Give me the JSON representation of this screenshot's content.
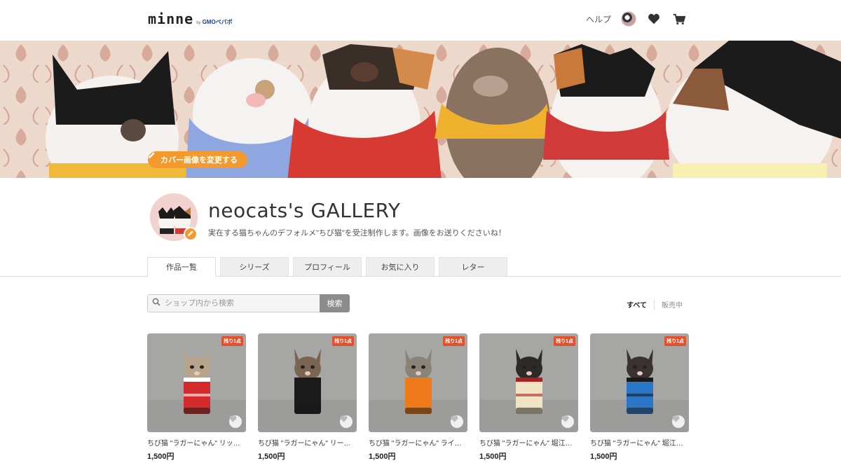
{
  "header": {
    "logo": "minne",
    "logo_by": "by",
    "logo_company": "GMOペパボ",
    "help_label": "ヘルプ",
    "icons": [
      "avatar",
      "heart-icon",
      "cart-icon"
    ]
  },
  "cover": {
    "change_button_label": "カバー画像を変更する",
    "accent_color": "#f29a2e"
  },
  "profile": {
    "shop_name": "neocats's GALLERY",
    "description": "実在する猫ちゃんのデフォルメ\"ちび猫\"を受注制作します。画像をお送りくださいね！"
  },
  "tabs": [
    {
      "label": "作品一覧",
      "active": true
    },
    {
      "label": "シリーズ",
      "active": false
    },
    {
      "label": "プロフィール",
      "active": false
    },
    {
      "label": "お気に入り",
      "active": false
    },
    {
      "label": "レター",
      "active": false
    }
  ],
  "search": {
    "placeholder": "ショップ内から検索",
    "button_label": "検索"
  },
  "filter": {
    "all_label": "すべて",
    "on_sale_label": "販売中"
  },
  "products": [
    {
      "badge": "残り1点",
      "title": "ちび猫 \"ラガーにゃん\" リッチ…",
      "price": "1,500円",
      "sweater": "#d32b2b",
      "sweater2": "#ffffff",
      "cat": "#b8a48a"
    },
    {
      "badge": "残り1点",
      "title": "ちび猫 \"ラガーにゃん\" リーコ…",
      "price": "1,500円",
      "sweater": "#1a1a1a",
      "sweater2": "#1a1a1a",
      "cat": "#7a6452"
    },
    {
      "badge": "残り1点",
      "title": "ちび猫 \"ラガーにゃん\" ライア…",
      "price": "1,500円",
      "sweater": "#ef7a1a",
      "sweater2": "#ef7a1a",
      "cat": "#8a8478"
    },
    {
      "badge": "残り1点",
      "title": "ちび猫 \"ラガーにゃん\" 堀江翔…",
      "price": "1,500円",
      "sweater": "#f0e4c4",
      "sweater2": "#a82020",
      "cat": "#2e2a28"
    },
    {
      "badge": "残り1点",
      "title": "ちび猫 \"ラガーにゃん\" 堀江翔…",
      "price": "1,500円",
      "sweater": "#2b77c7",
      "sweater2": "#1a1a1a",
      "cat": "#3a3230"
    }
  ]
}
